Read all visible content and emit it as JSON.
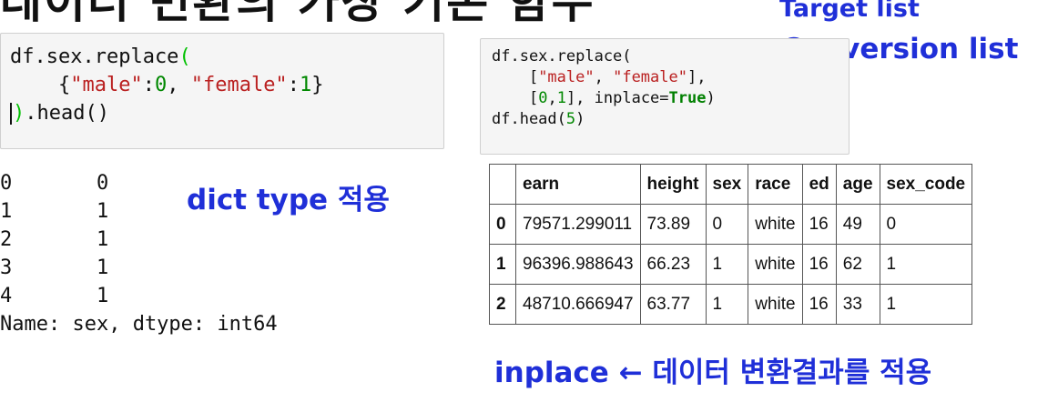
{
  "slide": {
    "title": "데이터 변환의 가장 기본 함수",
    "labels": {
      "target_list": "Target list",
      "conversion_list": "Conversion list",
      "dict_type": "dict type 적용",
      "inplace_note": "inplace ← 데이터 변환결과를 적용"
    }
  },
  "cell_left": {
    "lines": [
      {
        "text": "df.sex.replace("
      },
      {
        "text": "{\"male\":0, \"female\":1}"
      },
      {
        "text": ").head()"
      }
    ],
    "line1_call": "df.sex.replace",
    "line1_paren": "(",
    "line2_indent": "    ",
    "line2_open": "{",
    "line2_k1": "\"male\"",
    "line2_c1": ":",
    "line2_v1": "0",
    "line2_sep": ", ",
    "line2_k2": "\"female\"",
    "line2_c2": ":",
    "line2_v2": "1",
    "line2_close": "}",
    "line3_paren": ")",
    "line3_rest": ".head()"
  },
  "output_left": {
    "rows": [
      {
        "index": "0",
        "value": "0"
      },
      {
        "index": "1",
        "value": "1"
      },
      {
        "index": "2",
        "value": "1"
      },
      {
        "index": "3",
        "value": "1"
      },
      {
        "index": "4",
        "value": "1"
      }
    ],
    "footer": "Name: sex, dtype: int64"
  },
  "cell_right": {
    "l1": "df.sex.replace(",
    "l2_indent": "    [",
    "l2_s1": "\"male\"",
    "l2_sep": ", ",
    "l2_s2": "\"female\"",
    "l2_end": "],",
    "l3_indent": "    [",
    "l3_n1": "0",
    "l3_comma": ",",
    "l3_n2": "1",
    "l3_mid": "], inplace=",
    "l3_kw": "True",
    "l3_end": ")",
    "l4_a": "df.head(",
    "l4_n": "5",
    "l4_b": ")"
  },
  "dataframe": {
    "columns": [
      "",
      "earn",
      "height",
      "sex",
      "race",
      "ed",
      "age",
      "sex_code"
    ],
    "rows": [
      [
        "0",
        "79571.299011",
        "73.89",
        "0",
        "white",
        "16",
        "49",
        "0"
      ],
      [
        "1",
        "96396.988643",
        "66.23",
        "1",
        "white",
        "16",
        "62",
        "1"
      ],
      [
        "2",
        "48710.666947",
        "63.77",
        "1",
        "white",
        "16",
        "33",
        "1"
      ]
    ]
  },
  "colors": {
    "annotation_blue": "#1f2fd8",
    "string_red": "#ba2121",
    "number_green": "#008800",
    "code_background": "#f5f5f5"
  }
}
